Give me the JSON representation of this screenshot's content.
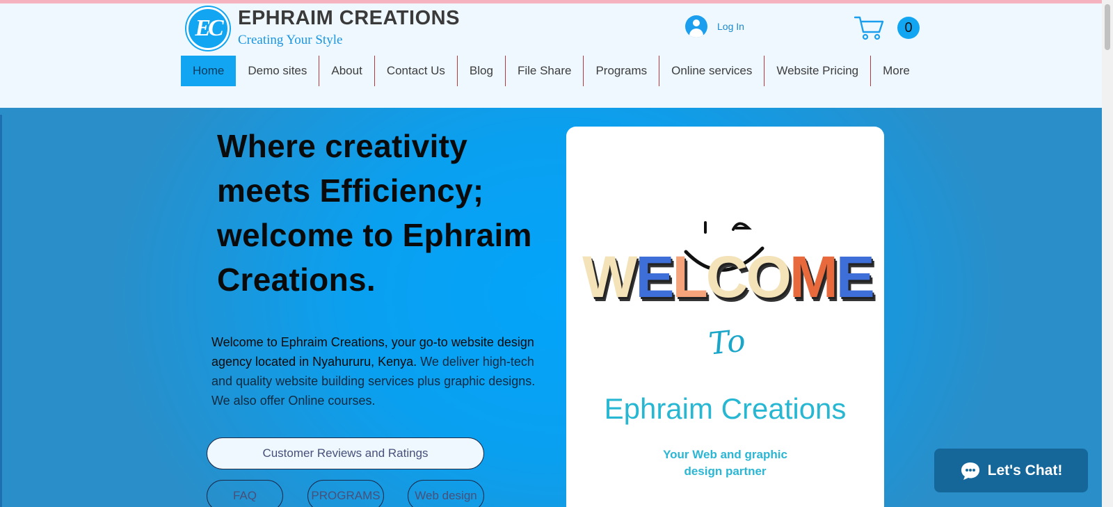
{
  "brand": {
    "logo_text": "EC",
    "title": "EPHRAIM CREATIONS",
    "tagline": "Creating Your Style"
  },
  "account": {
    "login_label": "Log In"
  },
  "cart": {
    "count": "0"
  },
  "nav": {
    "items": [
      {
        "label": "Home",
        "active": true
      },
      {
        "label": "Demo sites"
      },
      {
        "label": "About"
      },
      {
        "label": "Contact Us"
      },
      {
        "label": "Blog"
      },
      {
        "label": "File Share"
      },
      {
        "label": "Programs"
      },
      {
        "label": "Online services"
      },
      {
        "label": "Website Pricing"
      },
      {
        "label": "More"
      }
    ]
  },
  "hero": {
    "headline": "Where creativity meets Efficiency; welcome to Ephraim Creations.",
    "intro_strong": "Welcome to Ephraim Creations, your go-to website design agency located in Nyahururu, Kenya.",
    "intro_rest": " We deliver high-tech and quality website building services plus graphic designs. We also offer Online courses."
  },
  "buttons": {
    "reviews": "Customer Reviews and Ratings",
    "faq": "FAQ",
    "programs": "PROGRAMS",
    "web_design": "Web design"
  },
  "welcome_card": {
    "welcome_word": "WELCOME",
    "to": "To",
    "brand": "Ephraim Creations",
    "subtitle_line1": "Your Web and graphic",
    "subtitle_line2": "design partner"
  },
  "chat": {
    "label": "Let's Chat!"
  },
  "colors": {
    "accent": "#12a5f2",
    "nav_divider": "#b23a3a",
    "chat_bg": "#15679a",
    "hero_center": "#03a4fa"
  }
}
